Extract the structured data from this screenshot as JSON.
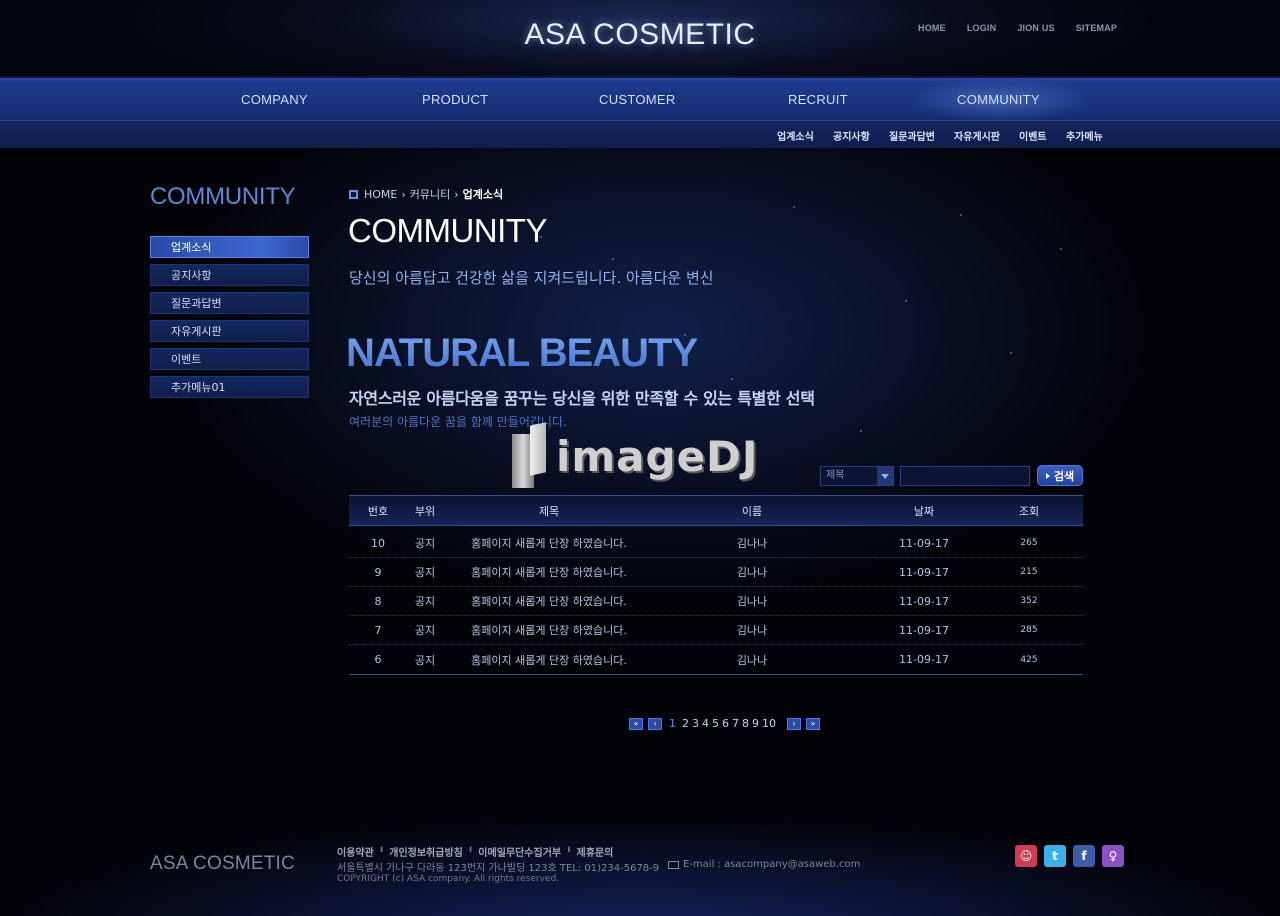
{
  "header": {
    "logo": "ASA COSMETIC",
    "util_links": [
      "HOME",
      "LOGIN",
      "JION US",
      "SITEMAP"
    ]
  },
  "gnb": [
    "COMPANY",
    "PRODUCT",
    "CUSTOMER",
    "RECRUIT",
    "COMMUNITY"
  ],
  "lnb": [
    "업계소식",
    "공지사항",
    "질문과답변",
    "자유게시판",
    "이벤트",
    "추가메뉴"
  ],
  "sidebar": {
    "title": "COMMUNITY",
    "items": [
      "업계소식",
      "공지사항",
      "질문과답변",
      "자유게시판",
      "이벤트",
      "추가메뉴01"
    ]
  },
  "breadcrumb": {
    "home": "HOME",
    "mid": "커뮤니티",
    "current": "업계소식"
  },
  "main": {
    "title": "COMMUNITY",
    "desc": "당신의 아름답고 건강한 삶을 지켜드립니다. 아름다운 변신",
    "banner_title": "NATURAL BEAUTY",
    "banner_sub": "자연스러운 아름다움을 꿈꾸는 당신을 위한 만족할 수 있는 특별한 선택",
    "banner_sub2": "여러분의 아름다운 꿈을 함께 만들어갑니다."
  },
  "watermark": "imageDJ",
  "search": {
    "select_value": "제목",
    "input_value": "",
    "button": "검색"
  },
  "table": {
    "headers": [
      "번호",
      "부위",
      "제목",
      "이름",
      "날짜",
      "조회"
    ],
    "rows": [
      [
        "10",
        "공지",
        "홈페이지 새롭게 단장 하였습니다.",
        "김나나",
        "11-09-17",
        "265"
      ],
      [
        "9",
        "공지",
        "홈페이지 새롭게 단장 하였습니다.",
        "김나나",
        "11-09-17",
        "215"
      ],
      [
        "8",
        "공지",
        "홈페이지 새롭게 단장 하였습니다.",
        "김나나",
        "11-09-17",
        "352"
      ],
      [
        "7",
        "공지",
        "홈페이지 새롭게 단장 하였습니다.",
        "김나나",
        "11-09-17",
        "285"
      ],
      [
        "6",
        "공지",
        "홈페이지 새롭게 단장 하였습니다.",
        "김나나",
        "11-09-17",
        "425"
      ]
    ]
  },
  "pagination": {
    "pages": [
      "1",
      "2",
      "3",
      "4",
      "5",
      "6",
      "7",
      "8",
      "9",
      "10"
    ],
    "current": "1"
  },
  "footer": {
    "logo": "ASA COSMETIC",
    "links": [
      "이용약관",
      "개인정보취급방침",
      "이메일무단수집거부",
      "제휴문의"
    ],
    "address": "서울특별시 가나구 다라동 123번지 가나빌딩 123호  TEL: 01)234-5678-9",
    "email": "E-mail : asacompany@asaweb.com",
    "copyright": "COPYRIGHT (c) ASA company. All rights reserved."
  },
  "colors": {
    "accent": "#2a4aa8",
    "nav": "#1e3a8e",
    "background": "#020309"
  }
}
